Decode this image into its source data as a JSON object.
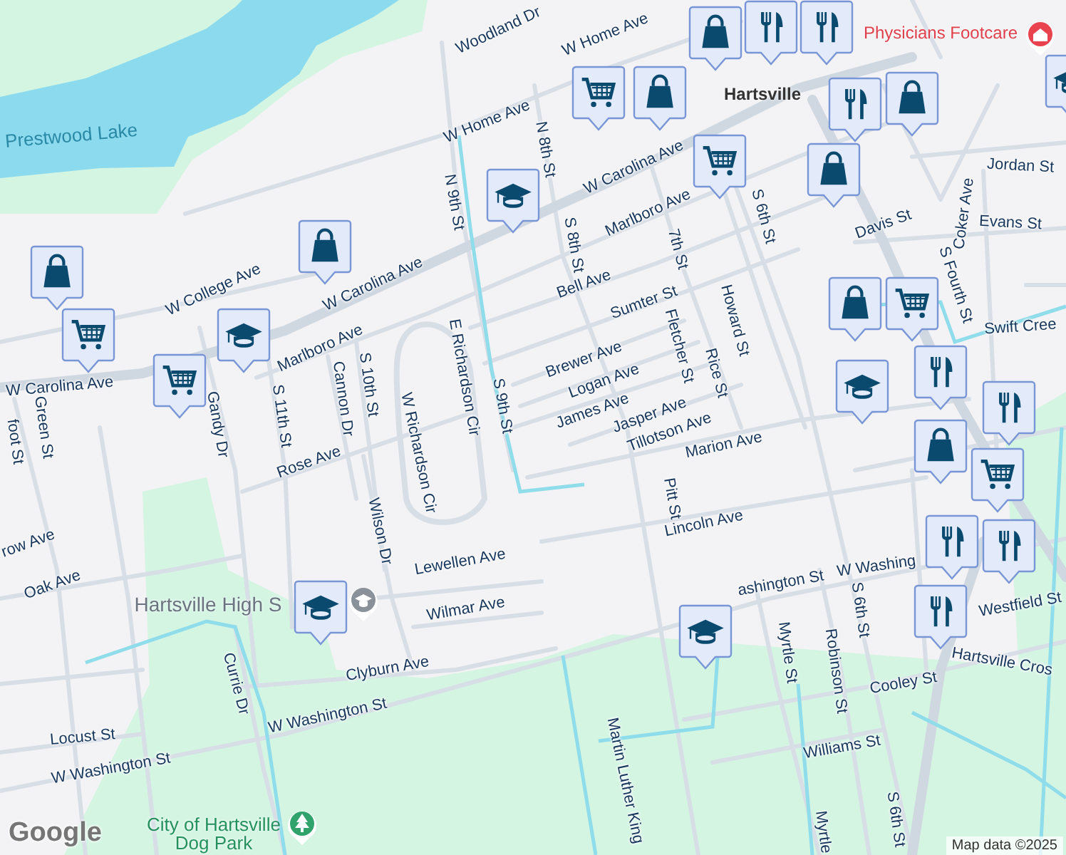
{
  "map": {
    "streets": [
      {
        "name": "Woodland Dr"
      },
      {
        "name": "W Home Ave"
      },
      {
        "name": "W Home Ave"
      },
      {
        "name": "N 9th St"
      },
      {
        "name": "N 8th St"
      },
      {
        "name": "S 8th St"
      },
      {
        "name": "W Carolina Ave"
      },
      {
        "name": "W College Ave"
      },
      {
        "name": "W Carolina Ave"
      },
      {
        "name": "W Carolina Ave"
      },
      {
        "name": "Marlboro Ave"
      },
      {
        "name": "S 6th St"
      },
      {
        "name": "7th St"
      },
      {
        "name": "Bell Ave"
      },
      {
        "name": "Sumter St"
      },
      {
        "name": "Howard St"
      },
      {
        "name": "Fletcher St"
      },
      {
        "name": "Rice St"
      },
      {
        "name": "Brewer Ave"
      },
      {
        "name": "Logan Ave"
      },
      {
        "name": "James Ave"
      },
      {
        "name": "Jasper Ave"
      },
      {
        "name": "Tillotson Ave"
      },
      {
        "name": "Marion Ave"
      },
      {
        "name": "Pitt St"
      },
      {
        "name": "Lincoln Ave"
      },
      {
        "name": "Davis St"
      },
      {
        "name": "Jordan St"
      },
      {
        "name": "Evans St"
      },
      {
        "name": "Coker Ave"
      },
      {
        "name": "S Fourth St"
      },
      {
        "name": "Swift Cree"
      },
      {
        "name": "S 11th St"
      },
      {
        "name": "Marlboro Ave"
      },
      {
        "name": "Cannon Dr"
      },
      {
        "name": "S 10th St"
      },
      {
        "name": "W Richardson Cir"
      },
      {
        "name": "E Richardson Cir"
      },
      {
        "name": "S 9th St"
      },
      {
        "name": "Gandy Dr"
      },
      {
        "name": "Green St"
      },
      {
        "name": "foot St"
      },
      {
        "name": "Rose Ave"
      },
      {
        "name": "Wilson Dr"
      },
      {
        "name": "row Ave"
      },
      {
        "name": "Oak Ave"
      },
      {
        "name": "Lewellen Ave"
      },
      {
        "name": "Wilmar Ave"
      },
      {
        "name": "Currie Dr"
      },
      {
        "name": "Clyburn Ave"
      },
      {
        "name": "W Washington St"
      },
      {
        "name": "Locust St"
      },
      {
        "name": "W Washington St"
      },
      {
        "name": "Martin Luther King"
      },
      {
        "name": "ashington St"
      },
      {
        "name": "W Washing"
      },
      {
        "name": "Myrtle St"
      },
      {
        "name": "Robinson St"
      },
      {
        "name": "S 6th St"
      },
      {
        "name": "Westfield St"
      },
      {
        "name": "Hartsville Cros"
      },
      {
        "name": "Cooley St"
      },
      {
        "name": "Williams St"
      },
      {
        "name": "S 6th St"
      },
      {
        "name": "Myrtle"
      }
    ],
    "places": [
      {
        "kind": "water",
        "name": "Prestwood Lake"
      },
      {
        "kind": "town",
        "name": "Hartsville"
      },
      {
        "kind": "hospital",
        "name": "Physicians Footcare"
      },
      {
        "kind": "school",
        "name": "Hartsville High S"
      },
      {
        "kind": "park",
        "name": "City of Hartsville Dog Park"
      }
    ],
    "pois": [
      {
        "kind": "bag"
      },
      {
        "kind": "bag"
      },
      {
        "kind": "cart"
      },
      {
        "kind": "cart"
      },
      {
        "kind": "cap"
      },
      {
        "kind": "cap"
      },
      {
        "kind": "cart"
      },
      {
        "kind": "bag"
      },
      {
        "kind": "cart"
      },
      {
        "kind": "bag"
      },
      {
        "kind": "fork"
      },
      {
        "kind": "fork"
      },
      {
        "kind": "fork"
      },
      {
        "kind": "bag"
      },
      {
        "kind": "bag"
      },
      {
        "kind": "bag"
      },
      {
        "kind": "cart"
      },
      {
        "kind": "fork"
      },
      {
        "kind": "cap"
      },
      {
        "kind": "fork"
      },
      {
        "kind": "bag"
      },
      {
        "kind": "cart"
      },
      {
        "kind": "fork"
      },
      {
        "kind": "fork"
      },
      {
        "kind": "fork"
      },
      {
        "kind": "cap"
      },
      {
        "kind": "cap"
      },
      {
        "kind": "cap"
      }
    ],
    "attribution": "Map data ©2025",
    "logo": "Google"
  }
}
